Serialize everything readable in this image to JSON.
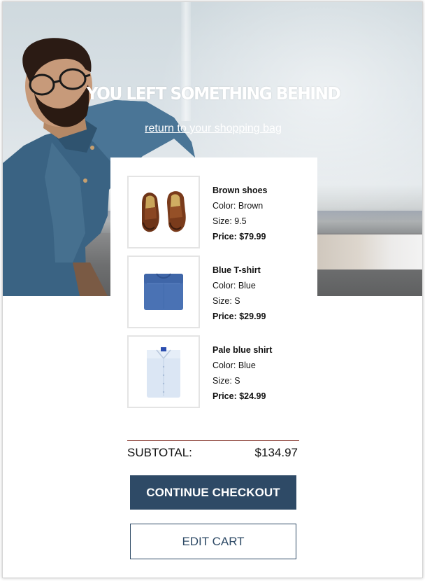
{
  "hero": {
    "title": "YOU LEFT SOMETHING BEHIND",
    "link_text": "return to your shopping bag"
  },
  "items": [
    {
      "name": "Brown shoes",
      "color": "Color: Brown",
      "size": "Size: 9.5",
      "price": "Price: $79.99",
      "icon": "brown-shoes-icon"
    },
    {
      "name": "Blue T-shirt",
      "color": "Color: Blue",
      "size": "Size: S",
      "price": "Price: $29.99",
      "icon": "blue-tshirt-icon"
    },
    {
      "name": "Pale blue shirt",
      "color": "Color: Blue",
      "size": "Size: S",
      "price": "Price: $24.99",
      "icon": "pale-blue-shirt-icon"
    }
  ],
  "summary": {
    "subtotal_label": "SUBTOTAL:",
    "subtotal_value": "$134.97"
  },
  "actions": {
    "continue_label": "CONTINUE CHECKOUT",
    "edit_label": "EDIT CART"
  },
  "colors": {
    "primary": "#2e4a66",
    "divider": "#8a3d35",
    "thumb_border": "#e4e4e4"
  }
}
